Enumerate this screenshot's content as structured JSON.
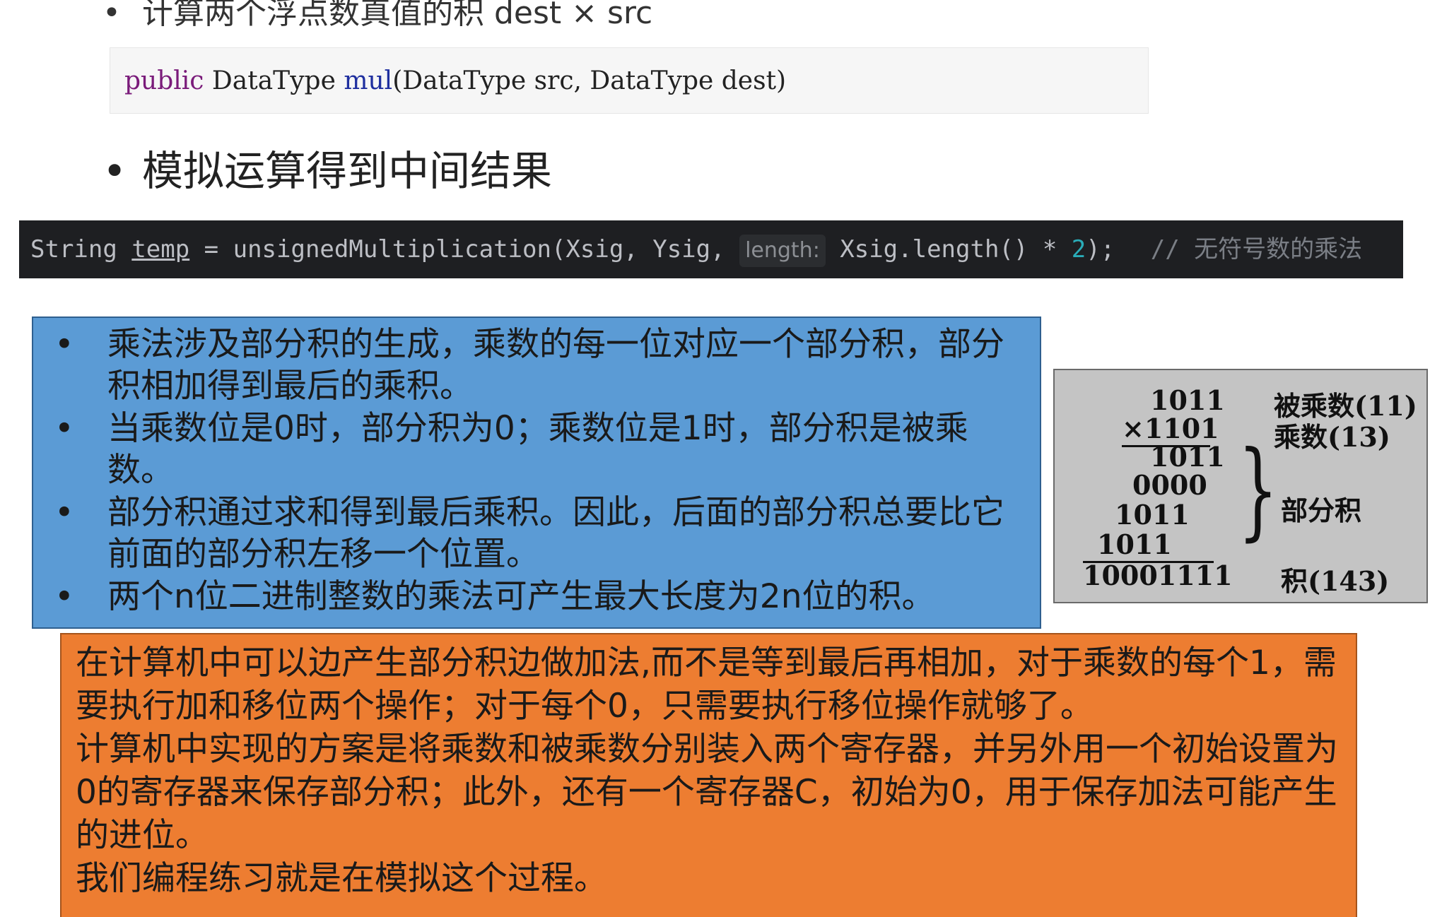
{
  "top_bullet": "计算两个浮点数真值的积 dest × src",
  "signature": {
    "keyword": "public",
    "return_type": "DataType",
    "method": "mul",
    "params": "(DataType src, DataType dest)"
  },
  "heading_bullet": "模拟运算得到中间结果",
  "code_line": {
    "type": "String",
    "var": "temp",
    "assign": " = unsignedMultiplication(Xsig, Ysig, ",
    "hint": "length:",
    "expr": " Xsig.length() * ",
    "num": "2",
    "end": ");",
    "comment": "// 无符号数的乘法"
  },
  "blue_box": {
    "items": [
      "乘法涉及部分积的生成，乘数的每一位对应一个部分积，部分积相加得到最后的乘积。",
      "当乘数位是0时，部分积为0；乘数位是1时，部分积是被乘数。",
      "部分积通过求和得到最后乘积。因此，后面的部分积总要比它前面的部分积左移一个位置。",
      "两个n位二进制整数的乘法可产生最大长度为2n位的积。"
    ]
  },
  "figure": {
    "multiplicand": "1011",
    "multiplier": "×1101",
    "partials": [
      "1011",
      "0000",
      "1011",
      "1011"
    ],
    "product": "10001111",
    "label_multiplicand": "被乘数(11)",
    "label_multiplier": "乘数(13)",
    "label_partials": "部分积",
    "label_product": "积(143)"
  },
  "orange_box": {
    "paragraphs": [
      "在计算机中可以边产生部分积边做加法,而不是等到最后再相加，对于乘数的每个1，需要执行加和移位两个操作；对于每个0，只需要执行移位操作就够了。",
      "计算机中实现的方案是将乘数和被乘数分别装入两个寄存器，并另外用一个初始设置为0的寄存器来保存部分积；此外，还有一个寄存器C，初始为0，用于保存加法可能产生的进位。",
      "我们编程练习就是在模拟这个过程。"
    ]
  }
}
